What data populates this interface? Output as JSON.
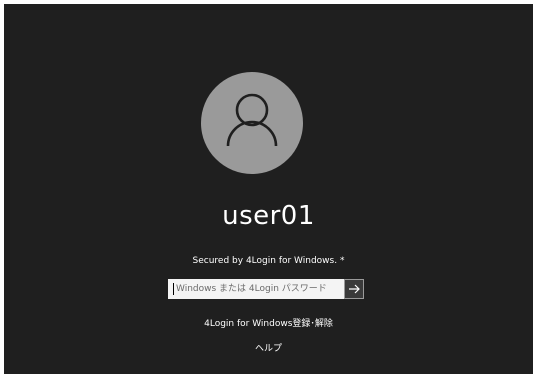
{
  "user": {
    "name": "user01",
    "avatar_icon": "user-icon"
  },
  "security": {
    "secured_text": "Secured by 4Login for  Windows. *"
  },
  "password": {
    "placeholder": "Windows または 4Login パスワード",
    "value": "",
    "submit_icon": "arrow-right-icon"
  },
  "links": {
    "register": "4Login for Windows登録･解除",
    "help": "ヘルプ"
  },
  "colors": {
    "background": "#1f1f1f",
    "avatar": "#9a9a9a",
    "text": "#ffffff",
    "input_bg": "#f4f4f4"
  }
}
